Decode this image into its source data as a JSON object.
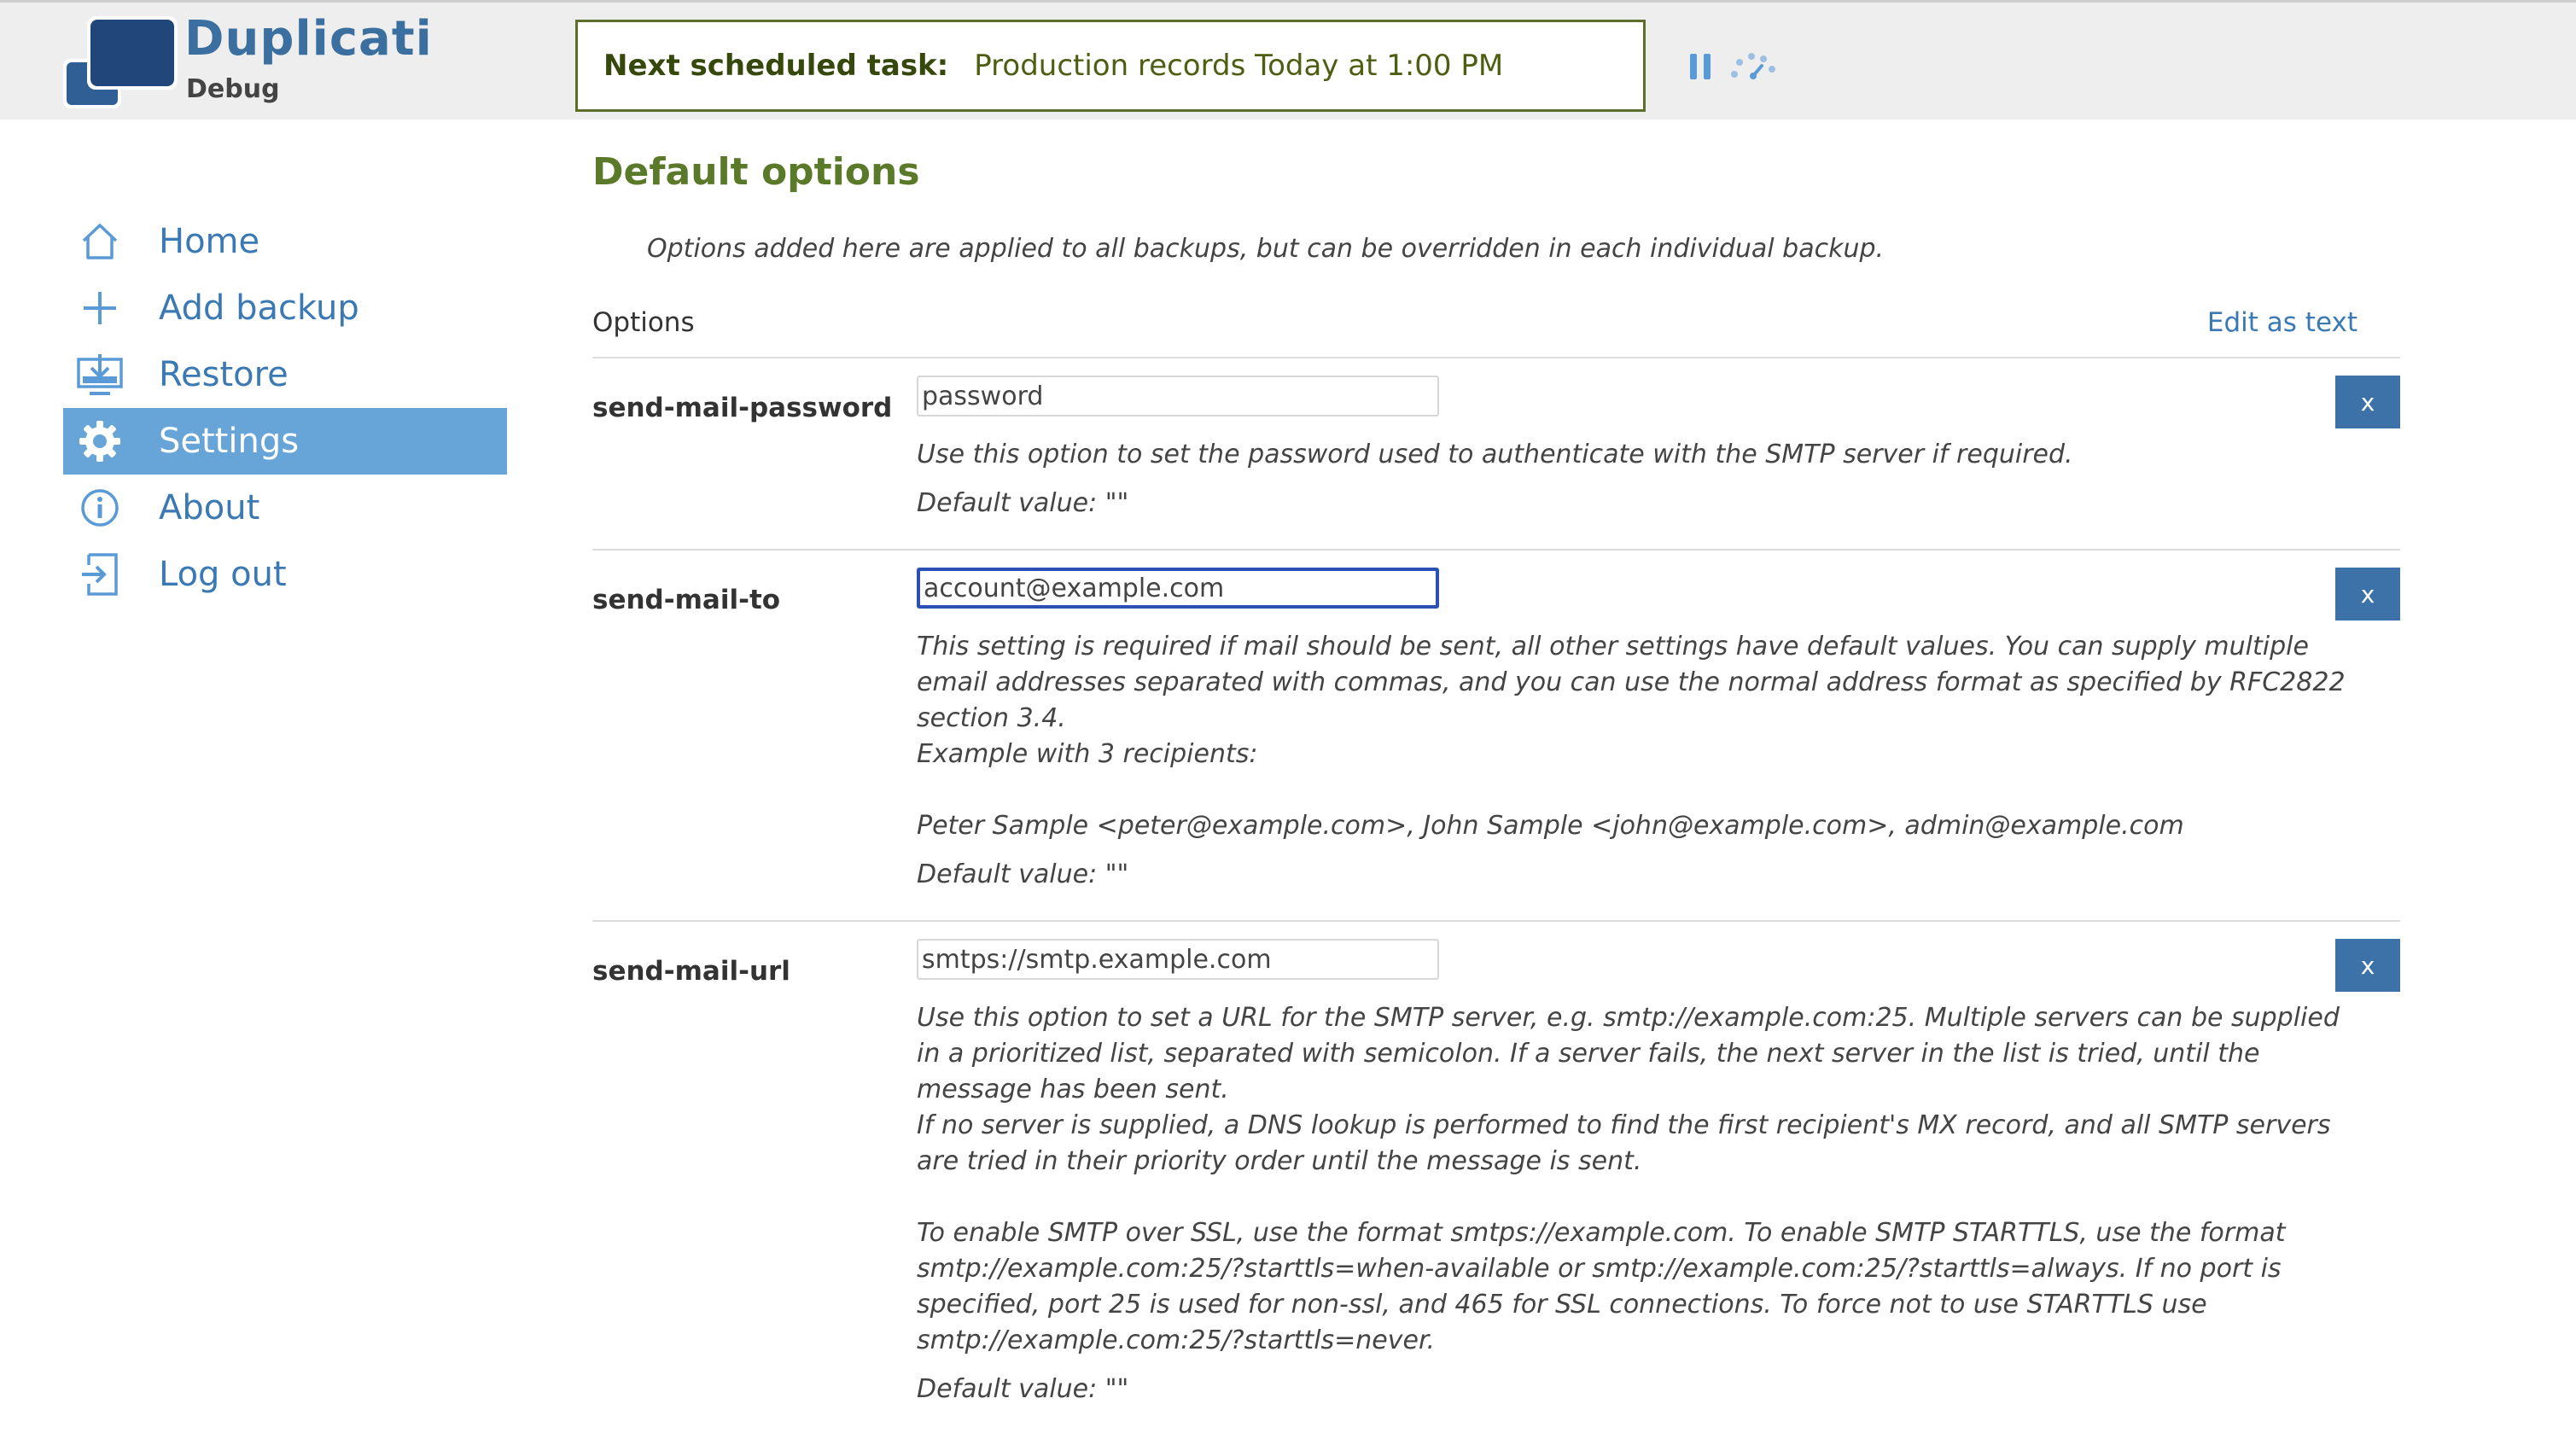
{
  "brand": {
    "title": "Duplicati",
    "subtitle": "Debug"
  },
  "header": {
    "next_task_label": "Next scheduled task:",
    "next_task_value": "Production records Today at 1:00 PM"
  },
  "sidebar": {
    "items": [
      {
        "label": "Home",
        "icon": "home-icon"
      },
      {
        "label": "Add backup",
        "icon": "plus-icon"
      },
      {
        "label": "Restore",
        "icon": "restore-icon"
      },
      {
        "label": "Settings",
        "icon": "gear-icon",
        "active": true
      },
      {
        "label": "About",
        "icon": "info-icon"
      },
      {
        "label": "Log out",
        "icon": "logout-icon"
      }
    ]
  },
  "main": {
    "title": "Default options",
    "intro": "Options added here are applied to all backups, but can be overridden in each individual backup.",
    "options_label": "Options",
    "edit_as_text": "Edit as text",
    "remove_label": "x",
    "options": [
      {
        "name": "send-mail-password",
        "value": "password",
        "description": "Use this option to set the password used to authenticate with the SMTP server if required.",
        "default": "Default value: \"\""
      },
      {
        "name": "send-mail-to",
        "value": "account@example.com",
        "description": "This setting is required if mail should be sent, all other settings have default values. You can supply multiple email addresses separated with commas, and you can use the normal address format as specified by RFC2822 section 3.4.\nExample with 3 recipients:\n\nPeter Sample <peter@example.com>, John Sample <john@example.com>, admin@example.com",
        "default": "Default value: \"\""
      },
      {
        "name": "send-mail-url",
        "value": "smtps://smtp.example.com",
        "description": "Use this option to set a URL for the SMTP server, e.g. smtp://example.com:25. Multiple servers can be supplied in a prioritized list, separated with semicolon. If a server fails, the next server in the list is tried, until the message has been sent.\nIf no server is supplied, a DNS lookup is performed to find the first recipient's MX record, and all SMTP servers are tried in their priority order until the message is sent.\n\nTo enable SMTP over SSL, use the format smtps://example.com. To enable SMTP STARTTLS, use the format smtp://example.com:25/?starttls=when-available or smtp://example.com:25/?starttls=always. If no port is specified, port 25 is used for non-ssl, and 465 for SSL connections. To force not to use STARTTLS use smtp://example.com:25/?starttls=never.",
        "default": "Default value: \"\""
      }
    ]
  },
  "colors": {
    "accent": "#3a79b3",
    "active_nav": "#67a4d7",
    "title_green": "#5a7a2a",
    "button": "#3d72a8",
    "focus_border": "#2b4fb5"
  }
}
